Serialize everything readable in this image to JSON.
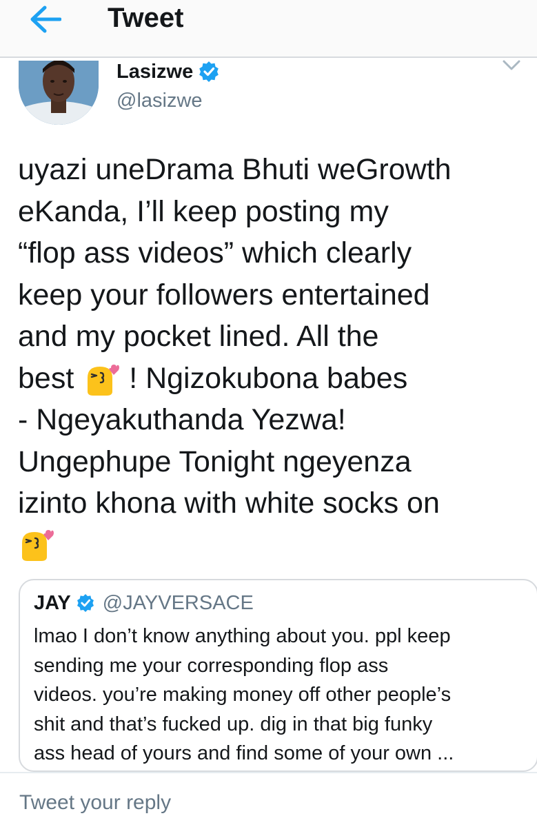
{
  "header": {
    "title": "Tweet",
    "back_icon": "arrow-left-icon"
  },
  "tweet": {
    "author": {
      "name": "Lasizwe",
      "handle": "@lasizwe",
      "verified": true
    },
    "lines": [
      "uyazi uneDrama Bhuti weGrowth",
      "eKanda, I’ll keep posting my",
      "“flop ass videos” which clearly",
      "keep your followers entertained",
      "and my pocket lined. All the"
    ],
    "line6_before": "best",
    "line6_after": "! Ngizokubona babes",
    "lines_after": [
      "- Ngeyakuthanda Yezwa!",
      "Ungephupe Tonight ngeyenza",
      "izinto khona with white socks on"
    ],
    "emoji": "face-blowing-a-kiss"
  },
  "quoted_tweet": {
    "name": "JAY",
    "handle": "@JAYVERSACE",
    "verified": true,
    "lines": [
      "lmao I don’t know anything about you. ppl keep",
      "sending me your corresponding flop ass",
      "videos. you’re making money off other people’s",
      "shit and that’s fucked up. dig in that big funky",
      "ass head of yours and find some of your own ..."
    ]
  },
  "reply": {
    "placeholder": "Tweet your reply"
  },
  "colors": {
    "accent": "#1da1f2",
    "text": "#14171a",
    "secondary": "#657786",
    "border": "#d7dade"
  }
}
